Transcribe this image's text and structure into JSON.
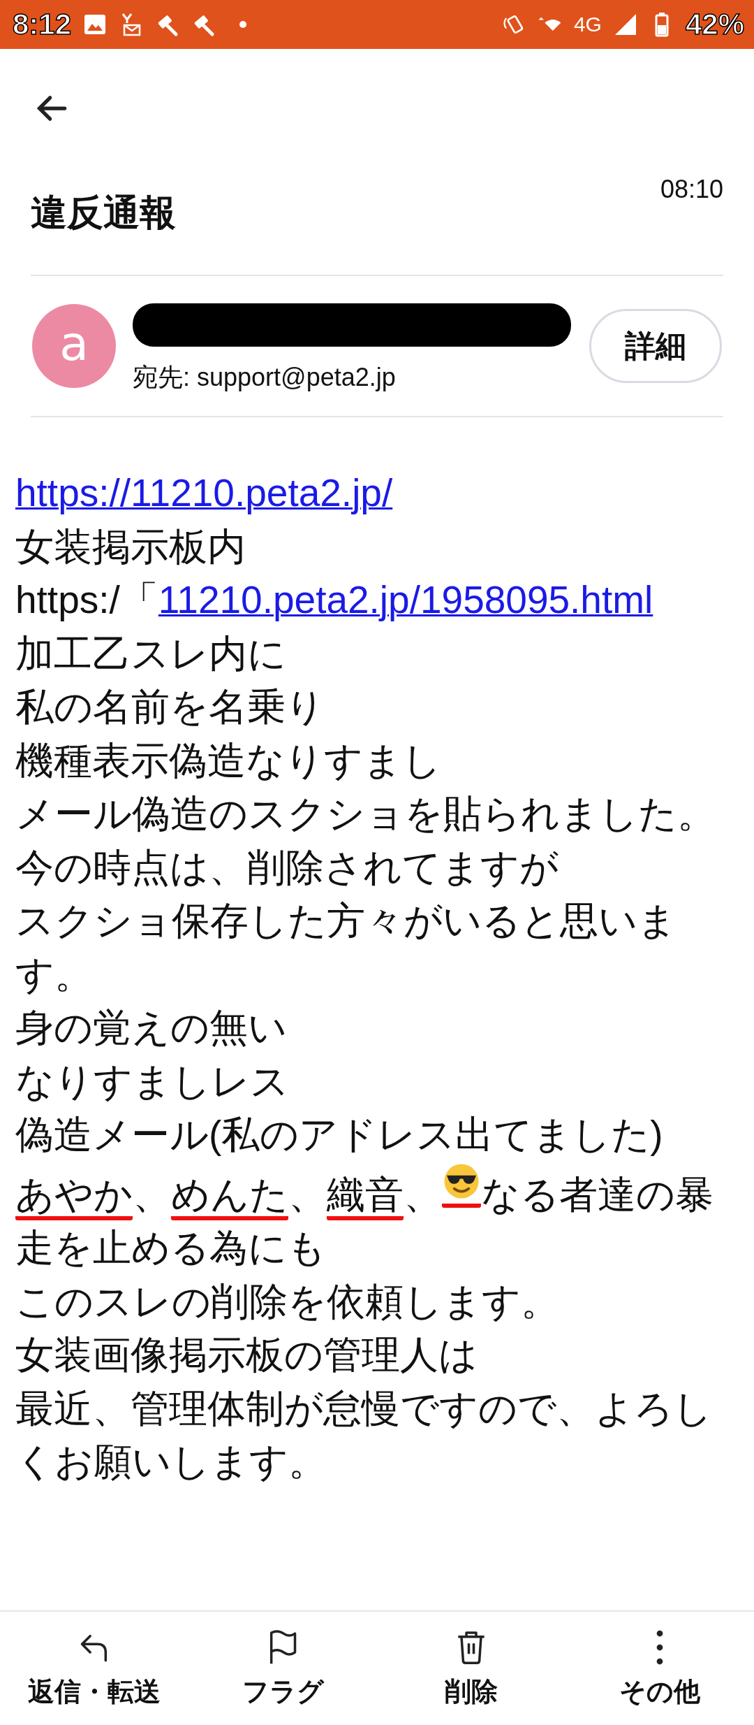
{
  "status_bar": {
    "time": "8:12",
    "notifications": [
      {
        "kind": "image"
      },
      {
        "kind": "mail"
      },
      {
        "kind": "gavel"
      },
      {
        "kind": "gavel"
      },
      {
        "kind": "dot"
      }
    ],
    "network": "4G",
    "battery": "42%"
  },
  "header": {
    "subject": "違反通報",
    "time": "08:10"
  },
  "sender": {
    "avatar_letter": "a",
    "name_redacted": true,
    "to": "宛先: support@peta2.jp",
    "details_button": "詳細"
  },
  "body": [
    {
      "parts": [
        {
          "text": "https://11210.peta2.jp/",
          "link": true
        }
      ]
    },
    {
      "parts": [
        {
          "text": "女装掲示板内"
        }
      ]
    },
    {
      "parts": [
        {
          "text": "https:/「"
        },
        {
          "text": "11210.peta2.jp/1958095.html",
          "link": true
        }
      ]
    },
    {
      "parts": [
        {
          "text": "加工乙スレ内に"
        }
      ]
    },
    {
      "parts": [
        {
          "text": "私の名前を名乗り"
        }
      ]
    },
    {
      "parts": [
        {
          "text": "機種表示偽造なりすまし"
        }
      ]
    },
    {
      "parts": [
        {
          "text": "メール偽造のスクショを貼られました。"
        }
      ]
    },
    {
      "parts": [
        {
          "text": "今の時点は、削除されてますが"
        }
      ]
    },
    {
      "parts": [
        {
          "text": "スクショ保存した方々がいると思います。"
        }
      ]
    },
    {
      "parts": [
        {
          "text": "身の覚えの無い"
        }
      ]
    },
    {
      "parts": [
        {
          "text": "なりすましレス"
        }
      ]
    },
    {
      "parts": [
        {
          "text": "偽造メール(私のアドレス出てました)"
        }
      ]
    },
    {
      "parts": [
        {
          "text": "あやか",
          "underlined": true
        },
        {
          "text": "、"
        },
        {
          "text": "めんた",
          "underlined": true
        },
        {
          "text": "、"
        },
        {
          "text": "織音",
          "underlined": true
        },
        {
          "text": "、"
        },
        {
          "kind": "emoji",
          "underlined": true
        },
        {
          "text": "なる者達の暴"
        }
      ]
    },
    {
      "parts": [
        {
          "text": "走を止める為にも"
        }
      ]
    },
    {
      "parts": [
        {
          "text": "このスレの削除を依頼します。"
        }
      ]
    },
    {
      "parts": [
        {
          "text": "女装画像掲示板の管理人は"
        }
      ]
    },
    {
      "parts": [
        {
          "text": "最近、管理体制が怠慢ですので、よろしくお願いします。"
        }
      ]
    }
  ],
  "actions": [
    {
      "kind": "reply",
      "label": "返信・転送"
    },
    {
      "kind": "flag",
      "label": "フラグ"
    },
    {
      "kind": "delete",
      "label": "削除"
    },
    {
      "kind": "more",
      "label": "その他"
    }
  ]
}
